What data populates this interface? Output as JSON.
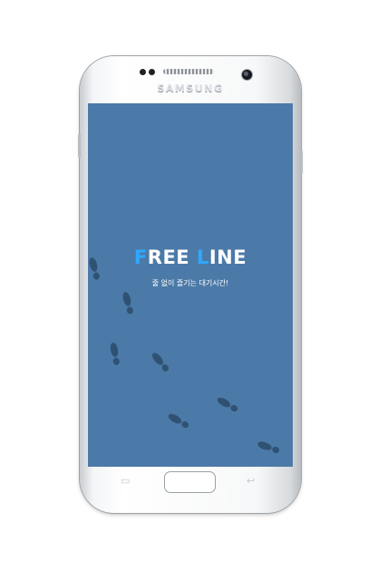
{
  "device": {
    "brand": "SAMSUNG"
  },
  "splash": {
    "title_part1_highlight": "F",
    "title_part1_rest": "REE ",
    "title_part2_highlight": "L",
    "title_part2_rest": "INE",
    "tagline": "줄 없이 즐기는 대기시간!"
  },
  "colors": {
    "screen_background": "#4c7aa8",
    "footprint": "#2f5273",
    "title_text": "#ffffff",
    "title_accent": "#2ea8ff"
  },
  "icons": {
    "recent_apps": "recent-apps-icon",
    "back": "back-icon"
  }
}
